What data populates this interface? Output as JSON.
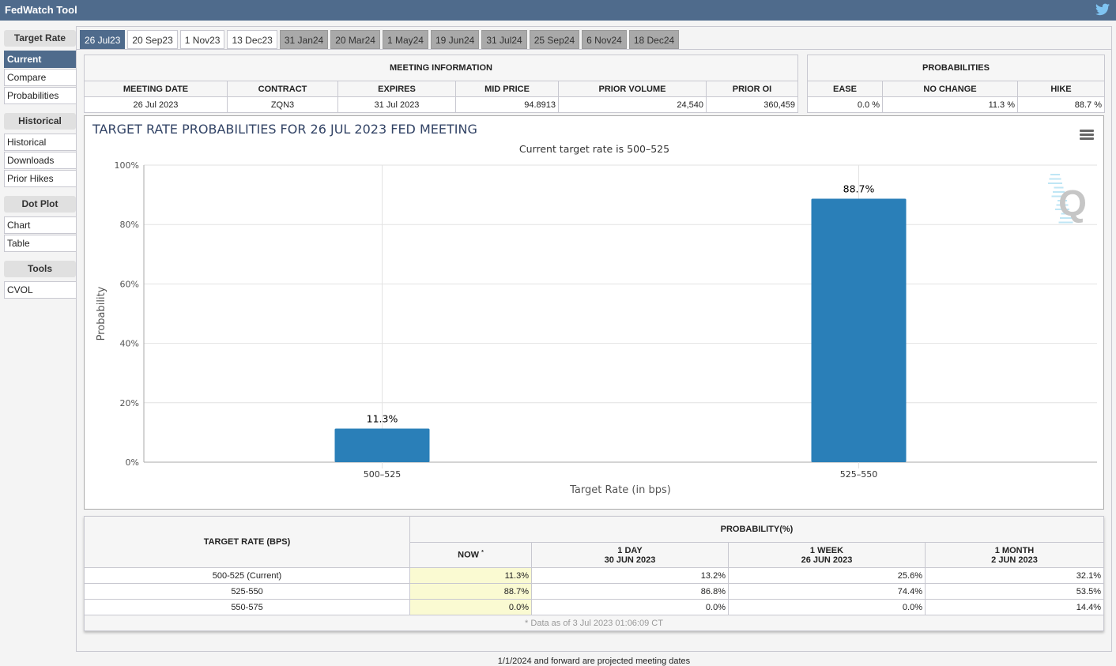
{
  "app": {
    "title": "FedWatch Tool",
    "share_icon": "twitter-icon"
  },
  "sidebar": {
    "groups": [
      {
        "header": "Target Rate",
        "items": [
          "Current",
          "Compare",
          "Probabilities"
        ],
        "active": "Current"
      },
      {
        "header": "Historical",
        "items": [
          "Historical",
          "Downloads",
          "Prior Hikes"
        ]
      },
      {
        "header": "Dot Plot",
        "items": [
          "Chart",
          "Table"
        ]
      },
      {
        "header": "Tools",
        "items": [
          "CVOL"
        ]
      }
    ]
  },
  "tabs": [
    {
      "label": "26 Jul23",
      "state": "active"
    },
    {
      "label": "20 Sep23",
      "state": "normal"
    },
    {
      "label": "1 Nov23",
      "state": "normal"
    },
    {
      "label": "13 Dec23",
      "state": "normal"
    },
    {
      "label": "31 Jan24",
      "state": "projected"
    },
    {
      "label": "20 Mar24",
      "state": "projected"
    },
    {
      "label": "1 May24",
      "state": "projected"
    },
    {
      "label": "19 Jun24",
      "state": "projected"
    },
    {
      "label": "31 Jul24",
      "state": "projected"
    },
    {
      "label": "25 Sep24",
      "state": "projected"
    },
    {
      "label": "6 Nov24",
      "state": "projected"
    },
    {
      "label": "18 Dec24",
      "state": "projected"
    }
  ],
  "meeting_info": {
    "title": "MEETING INFORMATION",
    "headers": [
      "MEETING DATE",
      "CONTRACT",
      "EXPIRES",
      "MID PRICE",
      "PRIOR VOLUME",
      "PRIOR OI"
    ],
    "values": [
      "26 Jul 2023",
      "ZQN3",
      "31 Jul 2023",
      "94.8913",
      "24,540",
      "360,459"
    ]
  },
  "probabilities": {
    "title": "PROBABILITIES",
    "headers": [
      "EASE",
      "NO CHANGE",
      "HIKE"
    ],
    "values": [
      "0.0 %",
      "11.3 %",
      "88.7 %"
    ]
  },
  "chart_data": {
    "type": "bar",
    "title": "TARGET RATE PROBABILITIES FOR 26 JUL 2023 FED MEETING",
    "subtitle": "Current target rate is 500–525",
    "xlabel": "Target Rate (in bps)",
    "ylabel": "Probability",
    "categories": [
      "500–525",
      "525–550"
    ],
    "values": [
      11.3,
      88.7
    ],
    "data_labels": [
      "11.3%",
      "88.7%"
    ],
    "ylim": [
      0,
      100
    ],
    "yticks": [
      0,
      20,
      40,
      60,
      80,
      100
    ],
    "ytick_labels": [
      "0%",
      "20%",
      "40%",
      "60%",
      "80%",
      "100%"
    ],
    "grid": true,
    "bar_color": "#2a7fb8",
    "watermark": "Q"
  },
  "history_table": {
    "rate_header": "TARGET RATE (BPS)",
    "prob_header": "PROBABILITY(%)",
    "columns": [
      {
        "label": "NOW",
        "sup": "*",
        "date": ""
      },
      {
        "label": "1 DAY",
        "date": "30 JUN 2023"
      },
      {
        "label": "1 WEEK",
        "date": "26 JUN 2023"
      },
      {
        "label": "1 MONTH",
        "date": "2 JUN 2023"
      }
    ],
    "rows": [
      {
        "rate": "500-525 (Current)",
        "values": [
          "11.3%",
          "13.2%",
          "25.6%",
          "32.1%"
        ]
      },
      {
        "rate": "525-550",
        "values": [
          "88.7%",
          "86.8%",
          "74.4%",
          "53.5%"
        ]
      },
      {
        "rate": "550-575",
        "values": [
          "0.0%",
          "0.0%",
          "0.0%",
          "14.4%"
        ]
      }
    ],
    "note": "* Data as of 3 Jul 2023 01:06:09 CT"
  },
  "footnote": "1/1/2024 and forward are projected meeting dates"
}
